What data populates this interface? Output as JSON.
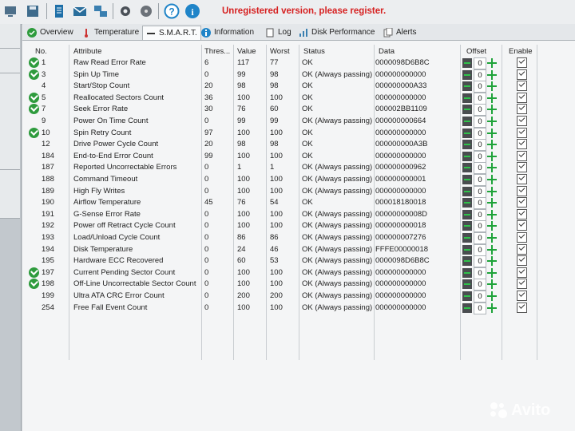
{
  "toolbar": {
    "unregistered_text": "Unregistered version, please register.",
    "icons": [
      "computer-icon",
      "save-icon",
      "report-icon",
      "email-icon",
      "network-icon",
      "settings-icon",
      "disk-icon",
      "help-icon",
      "info-icon"
    ]
  },
  "tabs": [
    {
      "label": "Overview",
      "icon": "check-icon"
    },
    {
      "label": "Temperature",
      "icon": "thermometer-icon"
    },
    {
      "label": "S.M.A.R.T.",
      "icon": "dash-icon",
      "active": true
    },
    {
      "label": "Information",
      "icon": "info-icon"
    },
    {
      "label": "Log",
      "icon": "log-icon"
    },
    {
      "label": "Disk Performance",
      "icon": "chart-icon"
    },
    {
      "label": "Alerts",
      "icon": "alerts-icon"
    }
  ],
  "table": {
    "headers": {
      "no": "No.",
      "attribute": "Attribute",
      "threshold": "Thres...",
      "value": "Value",
      "worst": "Worst",
      "status": "Status",
      "data": "Data",
      "offset": "Offset",
      "enable": "Enable"
    },
    "rows": [
      {
        "ok": true,
        "no": "1",
        "attribute": "Raw Read Error Rate",
        "threshold": "6",
        "value": "117",
        "worst": "77",
        "status": "OK",
        "data": "0000098D6B8C",
        "offset": "0"
      },
      {
        "ok": true,
        "no": "3",
        "attribute": "Spin Up Time",
        "threshold": "0",
        "value": "99",
        "worst": "98",
        "status": "OK (Always passing)",
        "data": "000000000000",
        "offset": "0"
      },
      {
        "ok": false,
        "no": "4",
        "attribute": "Start/Stop Count",
        "threshold": "20",
        "value": "98",
        "worst": "98",
        "status": "OK",
        "data": "000000000A33",
        "offset": "0"
      },
      {
        "ok": true,
        "no": "5",
        "attribute": "Reallocated Sectors Count",
        "threshold": "36",
        "value": "100",
        "worst": "100",
        "status": "OK",
        "data": "000000000000",
        "offset": "0"
      },
      {
        "ok": true,
        "no": "7",
        "attribute": "Seek Error Rate",
        "threshold": "30",
        "value": "76",
        "worst": "60",
        "status": "OK",
        "data": "000002BB1109",
        "offset": "0"
      },
      {
        "ok": false,
        "no": "9",
        "attribute": "Power On Time Count",
        "threshold": "0",
        "value": "99",
        "worst": "99",
        "status": "OK (Always passing)",
        "data": "000000000664",
        "offset": "0"
      },
      {
        "ok": true,
        "no": "10",
        "attribute": "Spin Retry Count",
        "threshold": "97",
        "value": "100",
        "worst": "100",
        "status": "OK",
        "data": "000000000000",
        "offset": "0"
      },
      {
        "ok": false,
        "no": "12",
        "attribute": "Drive Power Cycle Count",
        "threshold": "20",
        "value": "98",
        "worst": "98",
        "status": "OK",
        "data": "000000000A3B",
        "offset": "0"
      },
      {
        "ok": false,
        "no": "184",
        "attribute": "End-to-End Error Count",
        "threshold": "99",
        "value": "100",
        "worst": "100",
        "status": "OK",
        "data": "000000000000",
        "offset": "0"
      },
      {
        "ok": false,
        "no": "187",
        "attribute": "Reported Uncorrectable Errors",
        "threshold": "0",
        "value": "1",
        "worst": "1",
        "status": "OK (Always passing)",
        "data": "000000000962",
        "offset": "0"
      },
      {
        "ok": false,
        "no": "188",
        "attribute": "Command Timeout",
        "threshold": "0",
        "value": "100",
        "worst": "100",
        "status": "OK (Always passing)",
        "data": "000000000001",
        "offset": "0"
      },
      {
        "ok": false,
        "no": "189",
        "attribute": "High Fly Writes",
        "threshold": "0",
        "value": "100",
        "worst": "100",
        "status": "OK (Always passing)",
        "data": "000000000000",
        "offset": "0"
      },
      {
        "ok": false,
        "no": "190",
        "attribute": "Airflow Temperature",
        "threshold": "45",
        "value": "76",
        "worst": "54",
        "status": "OK",
        "data": "000018180018",
        "offset": "0"
      },
      {
        "ok": false,
        "no": "191",
        "attribute": "G-Sense Error Rate",
        "threshold": "0",
        "value": "100",
        "worst": "100",
        "status": "OK (Always passing)",
        "data": "00000000008D",
        "offset": "0"
      },
      {
        "ok": false,
        "no": "192",
        "attribute": "Power off Retract Cycle Count",
        "threshold": "0",
        "value": "100",
        "worst": "100",
        "status": "OK (Always passing)",
        "data": "000000000018",
        "offset": "0"
      },
      {
        "ok": false,
        "no": "193",
        "attribute": "Load/Unload Cycle Count",
        "threshold": "0",
        "value": "86",
        "worst": "86",
        "status": "OK (Always passing)",
        "data": "000000007276",
        "offset": "0"
      },
      {
        "ok": false,
        "no": "194",
        "attribute": "Disk Temperature",
        "threshold": "0",
        "value": "24",
        "worst": "46",
        "status": "OK (Always passing)",
        "data": "FFFE00000018",
        "offset": "0"
      },
      {
        "ok": false,
        "no": "195",
        "attribute": "Hardware ECC Recovered",
        "threshold": "0",
        "value": "60",
        "worst": "53",
        "status": "OK (Always passing)",
        "data": "0000098D6B8C",
        "offset": "0"
      },
      {
        "ok": true,
        "no": "197",
        "attribute": "Current Pending Sector Count",
        "threshold": "0",
        "value": "100",
        "worst": "100",
        "status": "OK (Always passing)",
        "data": "000000000000",
        "offset": "0"
      },
      {
        "ok": true,
        "no": "198",
        "attribute": "Off-Line Uncorrectable Sector Count",
        "threshold": "0",
        "value": "100",
        "worst": "100",
        "status": "OK (Always passing)",
        "data": "000000000000",
        "offset": "0"
      },
      {
        "ok": false,
        "no": "199",
        "attribute": "Ultra ATA CRC Error Count",
        "threshold": "0",
        "value": "200",
        "worst": "200",
        "status": "OK (Always passing)",
        "data": "000000000000",
        "offset": "0"
      },
      {
        "ok": false,
        "no": "254",
        "attribute": "Free Fall Event Count",
        "threshold": "0",
        "value": "100",
        "worst": "100",
        "status": "OK (Always passing)",
        "data": "000000000000",
        "offset": "0"
      }
    ]
  },
  "watermark": {
    "text": "Avito"
  },
  "colors": {
    "accent_red": "#d62020",
    "ok_green": "#2e9b3d",
    "plus_green": "#1fa33a"
  }
}
